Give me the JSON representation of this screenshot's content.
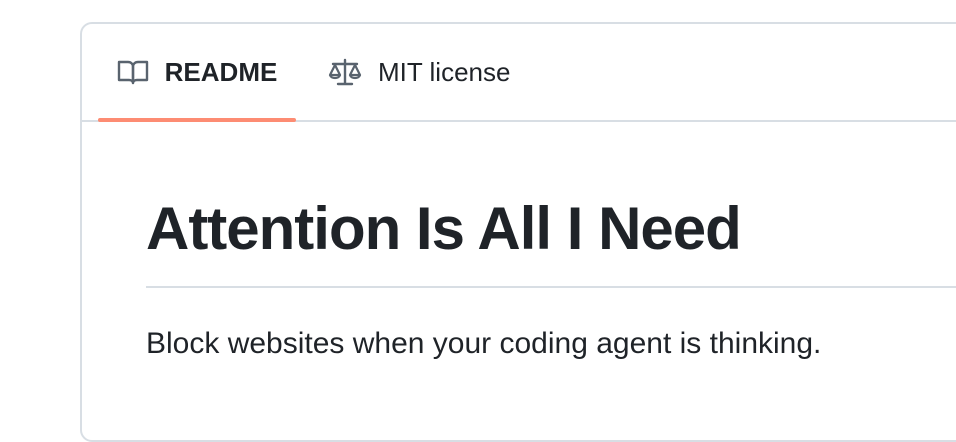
{
  "tabs": {
    "readme": {
      "label": "README",
      "icon": "book-icon"
    },
    "license": {
      "label": "MIT license",
      "icon": "law-icon"
    }
  },
  "readme": {
    "title": "Attention Is All I Need",
    "description": "Block websites when your coding agent is thinking."
  },
  "colors": {
    "text": "#1f2328",
    "border": "#d8dee4",
    "active_indicator": "#fd8c73",
    "icon": "#59636e"
  }
}
